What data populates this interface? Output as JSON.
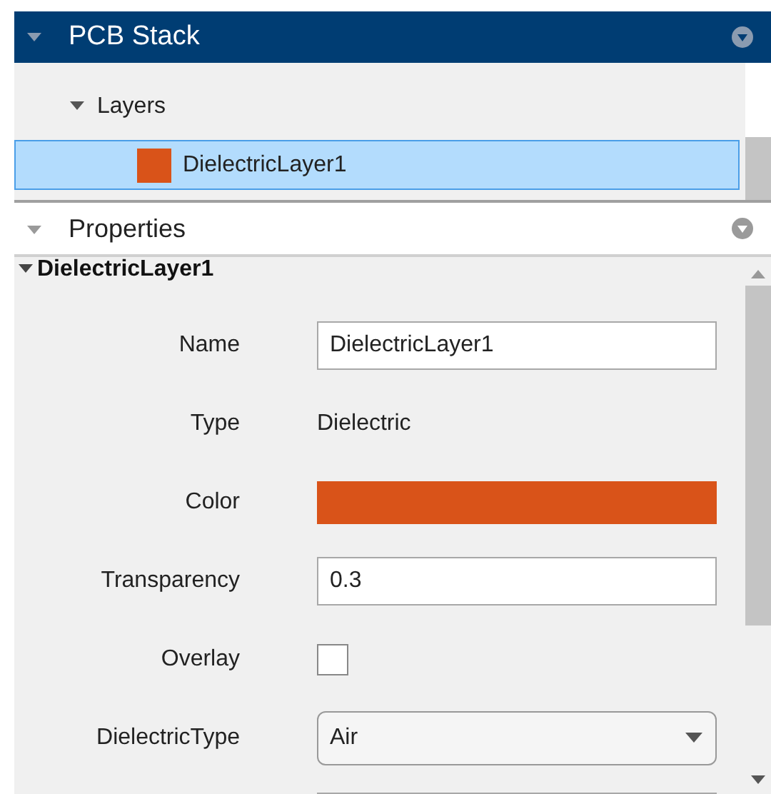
{
  "stack_panel": {
    "title": "PCB Stack",
    "expanded": true
  },
  "tree": {
    "label": "Layers",
    "expanded": true,
    "children": [
      {
        "label": "DielectricLayer1",
        "color": "#d95319",
        "selected": true
      }
    ]
  },
  "properties_panel": {
    "title": "Properties",
    "expanded": true
  },
  "section": {
    "title": "DielectricLayer1",
    "expanded": true
  },
  "properties": [
    {
      "kind": "field",
      "label": "Name",
      "value": "DielectricLayer1"
    },
    {
      "kind": "text",
      "label": "Type",
      "value": "Dielectric"
    },
    {
      "kind": "color",
      "label": "Color",
      "color": "#d95319"
    },
    {
      "kind": "field",
      "label": "Transparency",
      "value": "0.3"
    },
    {
      "kind": "checkbox",
      "label": "Overlay",
      "checked": false
    },
    {
      "kind": "dropdown",
      "label": "DielectricType",
      "value": "Air"
    },
    {
      "kind": "field"
    }
  ]
}
